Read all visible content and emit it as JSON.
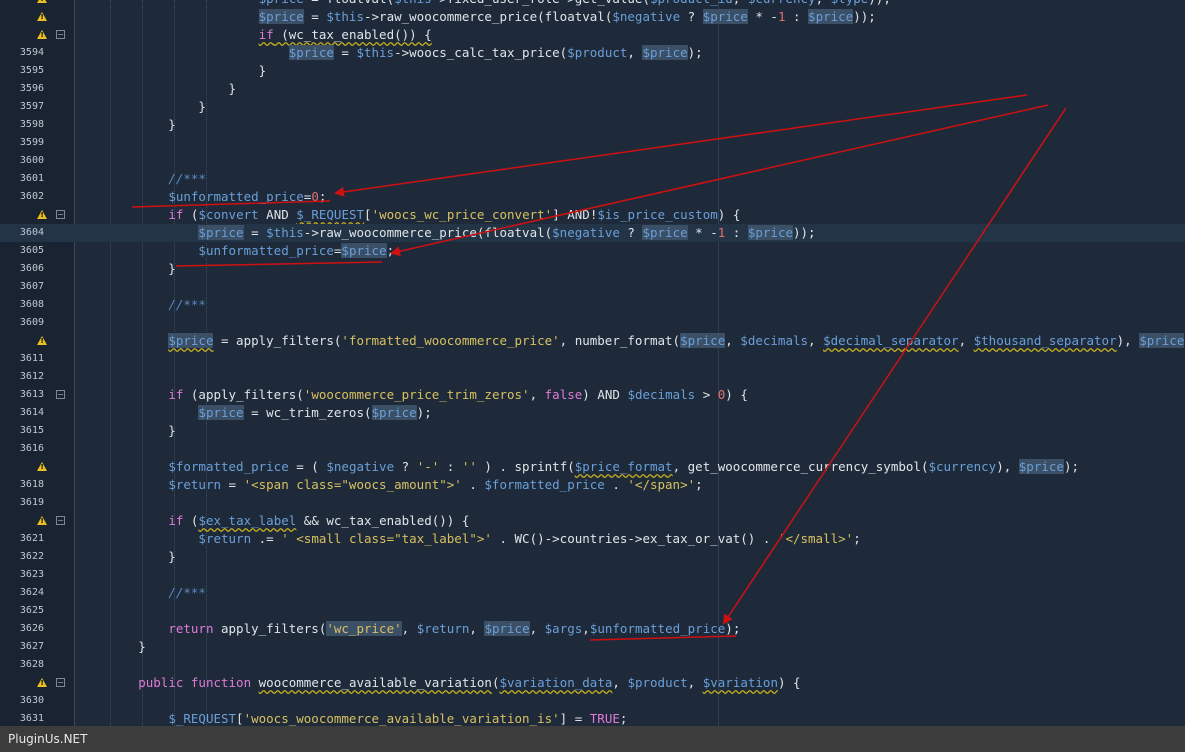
{
  "editor": {
    "lines": [
      {
        "num": "",
        "warn": true,
        "fold": false,
        "hl": false,
        "code": [
          [
            "o",
            "                        "
          ],
          [
            "v",
            "$price"
          ],
          [
            "o",
            " = floatval("
          ],
          [
            "v",
            "$this"
          ],
          [
            "o",
            "->fixed_user_role->get_value("
          ],
          [
            "v",
            "$product_id"
          ],
          [
            "o",
            ", "
          ],
          [
            "v",
            "$currency"
          ],
          [
            "o",
            ", "
          ],
          [
            "v",
            "$type"
          ],
          [
            "o",
            "));"
          ]
        ]
      },
      {
        "num": "",
        "warn": true,
        "fold": false,
        "hl": false,
        "code": [
          [
            "o",
            "                        "
          ],
          [
            "v m",
            "$price"
          ],
          [
            "o",
            " = "
          ],
          [
            "v",
            "$this"
          ],
          [
            "o",
            "->raw_woocommerce_price(floatval("
          ],
          [
            "v",
            "$negative"
          ],
          [
            "o",
            " ? "
          ],
          [
            "v m",
            "$price"
          ],
          [
            "o",
            " * -"
          ],
          [
            "n",
            "1"
          ],
          [
            "o",
            " : "
          ],
          [
            "v m",
            "$price"
          ],
          [
            "o",
            "));"
          ]
        ]
      },
      {
        "num": "",
        "warn": true,
        "fold": true,
        "hl": false,
        "code": [
          [
            "o",
            "                        "
          ],
          [
            "k u",
            "if"
          ],
          [
            "o u",
            " (wc_tax_enabled()) {"
          ]
        ]
      },
      {
        "num": "3594",
        "warn": false,
        "fold": false,
        "hl": false,
        "code": [
          [
            "o",
            "                            "
          ],
          [
            "v m",
            "$price"
          ],
          [
            "o",
            " = "
          ],
          [
            "v",
            "$this"
          ],
          [
            "o",
            "->woocs_calc_tax_price("
          ],
          [
            "v",
            "$product"
          ],
          [
            "o",
            ", "
          ],
          [
            "v m",
            "$price"
          ],
          [
            "o",
            ");"
          ]
        ]
      },
      {
        "num": "3595",
        "warn": false,
        "fold": false,
        "hl": false,
        "code": [
          [
            "o",
            "                        }"
          ]
        ]
      },
      {
        "num": "3596",
        "warn": false,
        "fold": false,
        "hl": false,
        "code": [
          [
            "o",
            "                    }"
          ]
        ]
      },
      {
        "num": "3597",
        "warn": false,
        "fold": false,
        "hl": false,
        "code": [
          [
            "o",
            "                }"
          ]
        ]
      },
      {
        "num": "3598",
        "warn": false,
        "fold": false,
        "hl": false,
        "code": [
          [
            "o",
            "            }"
          ]
        ]
      },
      {
        "num": "3599",
        "warn": false,
        "fold": false,
        "hl": false,
        "code": []
      },
      {
        "num": "3600",
        "warn": false,
        "fold": false,
        "hl": false,
        "code": []
      },
      {
        "num": "3601",
        "warn": false,
        "fold": false,
        "hl": false,
        "code": [
          [
            "o",
            "            "
          ],
          [
            "c",
            "//***"
          ]
        ]
      },
      {
        "num": "3602",
        "warn": false,
        "fold": false,
        "hl": false,
        "code": [
          [
            "o",
            "            "
          ],
          [
            "v",
            "$unformatted_price"
          ],
          [
            "o",
            "="
          ],
          [
            "n",
            "0"
          ],
          [
            "o",
            ";"
          ]
        ]
      },
      {
        "num": "",
        "warn": true,
        "fold": true,
        "hl": false,
        "code": [
          [
            "o",
            "            "
          ],
          [
            "k",
            "if"
          ],
          [
            "o",
            " ("
          ],
          [
            "v",
            "$convert"
          ],
          [
            "o",
            " AND "
          ],
          [
            "v u",
            "$_REQUEST"
          ],
          [
            "o",
            "["
          ],
          [
            "s",
            "'woocs_wc_price_convert'"
          ],
          [
            "o",
            "] AND!"
          ],
          [
            "v",
            "$is_price_custom"
          ],
          [
            "o",
            ") {"
          ]
        ]
      },
      {
        "num": "3604",
        "warn": false,
        "fold": false,
        "hl": true,
        "code": [
          [
            "o",
            "                "
          ],
          [
            "v m",
            "$price"
          ],
          [
            "o",
            " = "
          ],
          [
            "v",
            "$this"
          ],
          [
            "o",
            "->raw_woocommerce_price(floatval("
          ],
          [
            "v",
            "$negative"
          ],
          [
            "o",
            " ? "
          ],
          [
            "v m",
            "$price"
          ],
          [
            "o",
            " * -"
          ],
          [
            "n",
            "1"
          ],
          [
            "o",
            " : "
          ],
          [
            "v m",
            "$price"
          ],
          [
            "o",
            "));"
          ]
        ]
      },
      {
        "num": "3605",
        "warn": false,
        "fold": false,
        "hl": false,
        "code": [
          [
            "o",
            "                "
          ],
          [
            "v",
            "$unformatted_price"
          ],
          [
            "o",
            "="
          ],
          [
            "v m",
            "$price"
          ],
          [
            "o",
            ";"
          ]
        ]
      },
      {
        "num": "3606",
        "warn": false,
        "fold": false,
        "hl": false,
        "code": [
          [
            "o",
            "            }"
          ]
        ]
      },
      {
        "num": "3607",
        "warn": false,
        "fold": false,
        "hl": false,
        "code": []
      },
      {
        "num": "3608",
        "warn": false,
        "fold": false,
        "hl": false,
        "code": [
          [
            "o",
            "            "
          ],
          [
            "c",
            "//***"
          ]
        ]
      },
      {
        "num": "3609",
        "warn": false,
        "fold": false,
        "hl": false,
        "code": []
      },
      {
        "num": "",
        "warn": true,
        "fold": false,
        "hl": false,
        "code": [
          [
            "o",
            "            "
          ],
          [
            "v m u",
            "$price"
          ],
          [
            "o",
            " = apply_filters("
          ],
          [
            "s",
            "'formatted_woocommerce_price'"
          ],
          [
            "o",
            ", number_format("
          ],
          [
            "v m",
            "$price"
          ],
          [
            "o",
            ", "
          ],
          [
            "v",
            "$decimals"
          ],
          [
            "o",
            ", "
          ],
          [
            "v u",
            "$decimal_separator"
          ],
          [
            "o",
            ", "
          ],
          [
            "v u",
            "$thousand_separator"
          ],
          [
            "o",
            "), "
          ],
          [
            "v m",
            "$price"
          ]
        ]
      },
      {
        "num": "3611",
        "warn": false,
        "fold": false,
        "hl": false,
        "code": []
      },
      {
        "num": "3612",
        "warn": false,
        "fold": false,
        "hl": false,
        "code": []
      },
      {
        "num": "3613",
        "warn": false,
        "fold": true,
        "hl": false,
        "code": [
          [
            "o",
            "            "
          ],
          [
            "k",
            "if"
          ],
          [
            "o",
            " (apply_filters("
          ],
          [
            "s",
            "'woocommerce_price_trim_zeros'"
          ],
          [
            "o",
            ", "
          ],
          [
            "k",
            "false"
          ],
          [
            "o",
            ") AND "
          ],
          [
            "v",
            "$decimals"
          ],
          [
            "o",
            " > "
          ],
          [
            "n",
            "0"
          ],
          [
            "o",
            ") {"
          ]
        ]
      },
      {
        "num": "3614",
        "warn": false,
        "fold": false,
        "hl": false,
        "code": [
          [
            "o",
            "                "
          ],
          [
            "v m",
            "$price"
          ],
          [
            "o",
            " = wc_trim_zeros("
          ],
          [
            "v m",
            "$price"
          ],
          [
            "o",
            ");"
          ]
        ]
      },
      {
        "num": "3615",
        "warn": false,
        "fold": false,
        "hl": false,
        "code": [
          [
            "o",
            "            }"
          ]
        ]
      },
      {
        "num": "3616",
        "warn": false,
        "fold": false,
        "hl": false,
        "code": []
      },
      {
        "num": "",
        "warn": true,
        "fold": false,
        "hl": false,
        "code": [
          [
            "o",
            "            "
          ],
          [
            "v",
            "$formatted_price"
          ],
          [
            "o",
            " = ( "
          ],
          [
            "v",
            "$negative"
          ],
          [
            "o",
            " ? "
          ],
          [
            "s",
            "'-'"
          ],
          [
            "o",
            " : "
          ],
          [
            "s",
            "''"
          ],
          [
            "o",
            " ) . sprintf("
          ],
          [
            "v u",
            "$price_format"
          ],
          [
            "o",
            ", get_woocommerce_currency_symbol("
          ],
          [
            "v",
            "$currency"
          ],
          [
            "o",
            "), "
          ],
          [
            "v m",
            "$price"
          ],
          [
            "o",
            ");"
          ]
        ]
      },
      {
        "num": "3618",
        "warn": false,
        "fold": false,
        "hl": false,
        "code": [
          [
            "o",
            "            "
          ],
          [
            "v",
            "$return"
          ],
          [
            "o",
            " = "
          ],
          [
            "s",
            "'<span class=\"woocs_amount\">'"
          ],
          [
            "o",
            " . "
          ],
          [
            "v",
            "$formatted_price"
          ],
          [
            "o",
            " . "
          ],
          [
            "s",
            "'</span>'"
          ],
          [
            "o",
            ";"
          ]
        ]
      },
      {
        "num": "3619",
        "warn": false,
        "fold": false,
        "hl": false,
        "code": []
      },
      {
        "num": "",
        "warn": true,
        "fold": true,
        "hl": false,
        "code": [
          [
            "o",
            "            "
          ],
          [
            "k",
            "if"
          ],
          [
            "o",
            " ("
          ],
          [
            "v u",
            "$ex_tax_label"
          ],
          [
            "o",
            " && wc_tax_enabled()) {"
          ]
        ]
      },
      {
        "num": "3621",
        "warn": false,
        "fold": false,
        "hl": false,
        "code": [
          [
            "o",
            "                "
          ],
          [
            "v",
            "$return"
          ],
          [
            "o",
            " .= "
          ],
          [
            "s",
            "' <small class=\"tax_label\">'"
          ],
          [
            "o",
            " . WC()->countries->ex_tax_or_vat() . "
          ],
          [
            "s",
            "'</small>'"
          ],
          [
            "o",
            ";"
          ]
        ]
      },
      {
        "num": "3622",
        "warn": false,
        "fold": false,
        "hl": false,
        "code": [
          [
            "o",
            "            }"
          ]
        ]
      },
      {
        "num": "3623",
        "warn": false,
        "fold": false,
        "hl": false,
        "code": []
      },
      {
        "num": "3624",
        "warn": false,
        "fold": false,
        "hl": false,
        "code": [
          [
            "o",
            "            "
          ],
          [
            "c",
            "//***"
          ]
        ]
      },
      {
        "num": "3625",
        "warn": false,
        "fold": false,
        "hl": false,
        "code": []
      },
      {
        "num": "3626",
        "warn": false,
        "fold": false,
        "hl": false,
        "code": [
          [
            "o",
            "            "
          ],
          [
            "k",
            "return"
          ],
          [
            "o",
            " apply_filters("
          ],
          [
            "s m",
            "'wc_price'"
          ],
          [
            "o",
            ", "
          ],
          [
            "v",
            "$return"
          ],
          [
            "o",
            ", "
          ],
          [
            "v m",
            "$price"
          ],
          [
            "o",
            ", "
          ],
          [
            "v",
            "$args"
          ],
          [
            "o",
            ","
          ],
          [
            "v",
            "$unformatted_price"
          ],
          [
            "o",
            ");"
          ]
        ]
      },
      {
        "num": "3627",
        "warn": false,
        "fold": false,
        "hl": false,
        "code": [
          [
            "o",
            "        }"
          ]
        ]
      },
      {
        "num": "3628",
        "warn": false,
        "fold": false,
        "hl": false,
        "code": []
      },
      {
        "num": "",
        "warn": true,
        "fold": true,
        "hl": false,
        "code": [
          [
            "o",
            "        "
          ],
          [
            "k",
            "public"
          ],
          [
            "o",
            " "
          ],
          [
            "k",
            "function"
          ],
          [
            "o",
            " "
          ],
          [
            "f u",
            "woocommerce_available_variation"
          ],
          [
            "o",
            "("
          ],
          [
            "v u",
            "$variation_data"
          ],
          [
            "o",
            ", "
          ],
          [
            "v",
            "$product"
          ],
          [
            "o",
            ", "
          ],
          [
            "v u",
            "$variation"
          ],
          [
            "o",
            ") {"
          ]
        ]
      },
      {
        "num": "3630",
        "warn": false,
        "fold": false,
        "hl": false,
        "code": []
      },
      {
        "num": "3631",
        "warn": false,
        "fold": false,
        "hl": false,
        "code": [
          [
            "o",
            "            "
          ],
          [
            "v u",
            "$_REQUEST"
          ],
          [
            "o",
            "["
          ],
          [
            "s u",
            "'woocs_woocommerce_available_variation_is'"
          ],
          [
            "o",
            "] = "
          ],
          [
            "k",
            "TRUE"
          ],
          [
            "o",
            ";"
          ]
        ]
      }
    ]
  },
  "status": {
    "text": "PluginUs.NET"
  },
  "colors": {
    "annotation": "#d01010",
    "background": "#1e2a3a",
    "warning": "#e8c020"
  }
}
